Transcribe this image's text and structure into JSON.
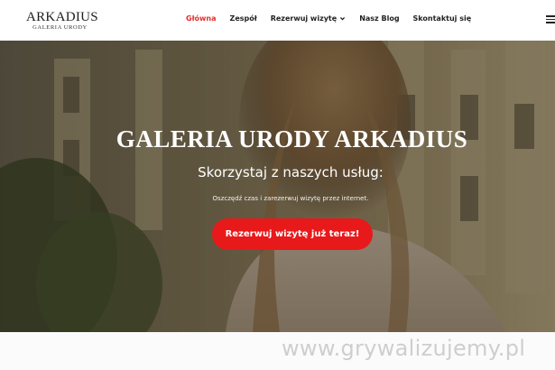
{
  "header": {
    "logo_main": "ARKADIUS",
    "logo_sub": "GALERIA URODY",
    "nav": [
      {
        "label": "Główna",
        "active": true
      },
      {
        "label": "Zespół"
      },
      {
        "label": "Rezerwuj wizytę",
        "has_dropdown": true
      },
      {
        "label": "Nasz Blog"
      },
      {
        "label": "Skontaktuj się"
      }
    ],
    "menu_icon": "hamburger-menu-icon"
  },
  "hero": {
    "title": "GALERIA URODY ARKADIUS",
    "subtitle": "Skorzystaj z naszych usług:",
    "note": "Oszczędź czas i zarezerwuj wizytę przez internet.",
    "cta_label": "Rezerwuj wizytę już teraz!"
  },
  "watermark": "www.grywalizujemy.pl",
  "colors": {
    "accent": "#e8191b",
    "active_nav": "#e0302c",
    "header_bg": "#ffffff"
  }
}
